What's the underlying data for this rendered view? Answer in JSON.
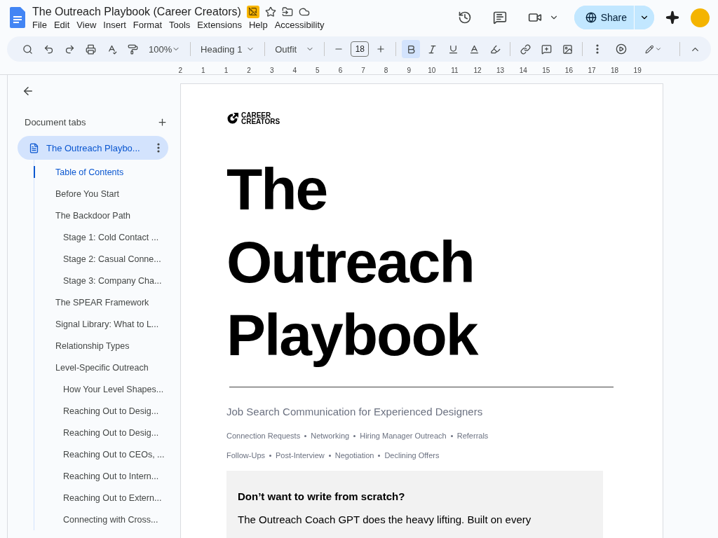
{
  "document": {
    "title": "The Outreach Playbook (Career Creators)"
  },
  "menu": [
    "File",
    "Edit",
    "View",
    "Insert",
    "Format",
    "Tools",
    "Extensions",
    "Help",
    "Accessibility"
  ],
  "share": {
    "label": "Share"
  },
  "toolbar": {
    "zoom": "100%",
    "style": "Heading 1",
    "font": "Outfit",
    "size": "18",
    "bold_active": true
  },
  "ruler": [
    "2",
    "1",
    "1",
    "2",
    "3",
    "4",
    "5",
    "6",
    "7",
    "8",
    "9",
    "10",
    "11",
    "12",
    "13",
    "14",
    "15",
    "16",
    "17",
    "18",
    "19"
  ],
  "sidebar": {
    "heading": "Document tabs",
    "tab": {
      "label": "The Outreach Playbo...",
      "selected": true
    },
    "outline": [
      {
        "label": "Table of Contents",
        "selected": true
      },
      {
        "label": "Before You Start",
        "selected": false
      },
      {
        "label": "The Backdoor Path",
        "selected": false,
        "children": [
          {
            "label": "Stage 1: Cold Contact ...",
            "selected": false
          },
          {
            "label": "Stage 2: Casual Conne...",
            "selected": false
          },
          {
            "label": "Stage 3: Company Cha...",
            "selected": false
          }
        ]
      },
      {
        "label": "The SPEAR Framework",
        "selected": false
      },
      {
        "label": "Signal Library: What to L...",
        "selected": false
      },
      {
        "label": "Relationship Types",
        "selected": false
      },
      {
        "label": "Level-Specific Outreach",
        "selected": false,
        "children": [
          {
            "label": "How Your Level Shapes...",
            "selected": false
          },
          {
            "label": "Reaching Out to Desig...",
            "selected": false
          },
          {
            "label": "Reaching Out to Desig...",
            "selected": false
          },
          {
            "label": "Reaching Out to CEOs, ...",
            "selected": false
          },
          {
            "label": "Reaching Out to Intern...",
            "selected": false
          },
          {
            "label": "Reaching Out to Extern...",
            "selected": false
          },
          {
            "label": "Connecting with Cross...",
            "selected": false
          }
        ]
      }
    ]
  },
  "page": {
    "logo": [
      "CAREER",
      "CREATORS"
    ],
    "title_lines": [
      "The",
      "Outreach",
      "Playbook"
    ],
    "subtitle": "Job Search Communication for Experienced Designers",
    "tag_lines": [
      [
        "Connection Requests",
        "Networking",
        "Hiring Manager Outreach",
        "Referrals"
      ],
      [
        "Follow-Ups",
        "Post-Interview",
        "Negotiation",
        "Declining Offers"
      ]
    ],
    "callout": {
      "heading": "Don’t want to write from scratch?",
      "text": "The Outreach Coach GPT does the heavy lifting. Built on every"
    }
  }
}
